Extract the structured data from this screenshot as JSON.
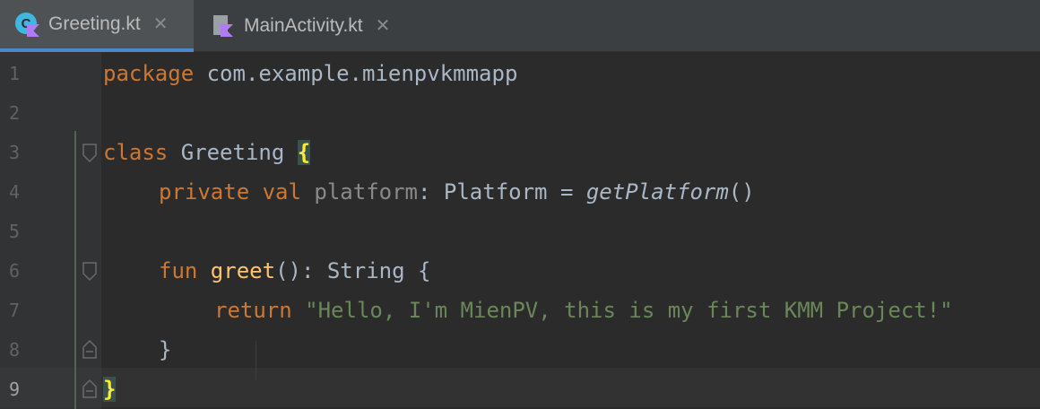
{
  "tabs": [
    {
      "label": "Greeting.kt",
      "active": true,
      "icon": "kotlin-class-icon"
    },
    {
      "label": "MainActivity.kt",
      "active": false,
      "icon": "kotlin-file-icon"
    }
  ],
  "close_glyph": "✕",
  "line_numbers": [
    "1",
    "2",
    "3",
    "4",
    "5",
    "6",
    "7",
    "8",
    "9"
  ],
  "code": {
    "l1_kw": "package",
    "l1_rest": " com.example.mienpvkmmapp",
    "l3_kw": "class",
    "l3_name": " Greeting ",
    "l3_brace": "{",
    "l4_kw": "private val",
    "l4_prop": " platform",
    "l4_type": ": Platform = ",
    "l4_call": "getPlatform",
    "l4_parens": "()",
    "l6_kw": "fun",
    "l6_fn": " greet",
    "l6_rest": "(): String {",
    "l7_kw": "return",
    "l7_str": " \"Hello, I'm MienPV, this is my first KMM Project!\"",
    "l8_brace": "}",
    "l9_brace": "}"
  },
  "colors": {
    "keyword": "#cc7832",
    "function": "#ffc66d",
    "string": "#6a8759",
    "text": "#a9b7c6",
    "accent": "#4a88c7"
  }
}
